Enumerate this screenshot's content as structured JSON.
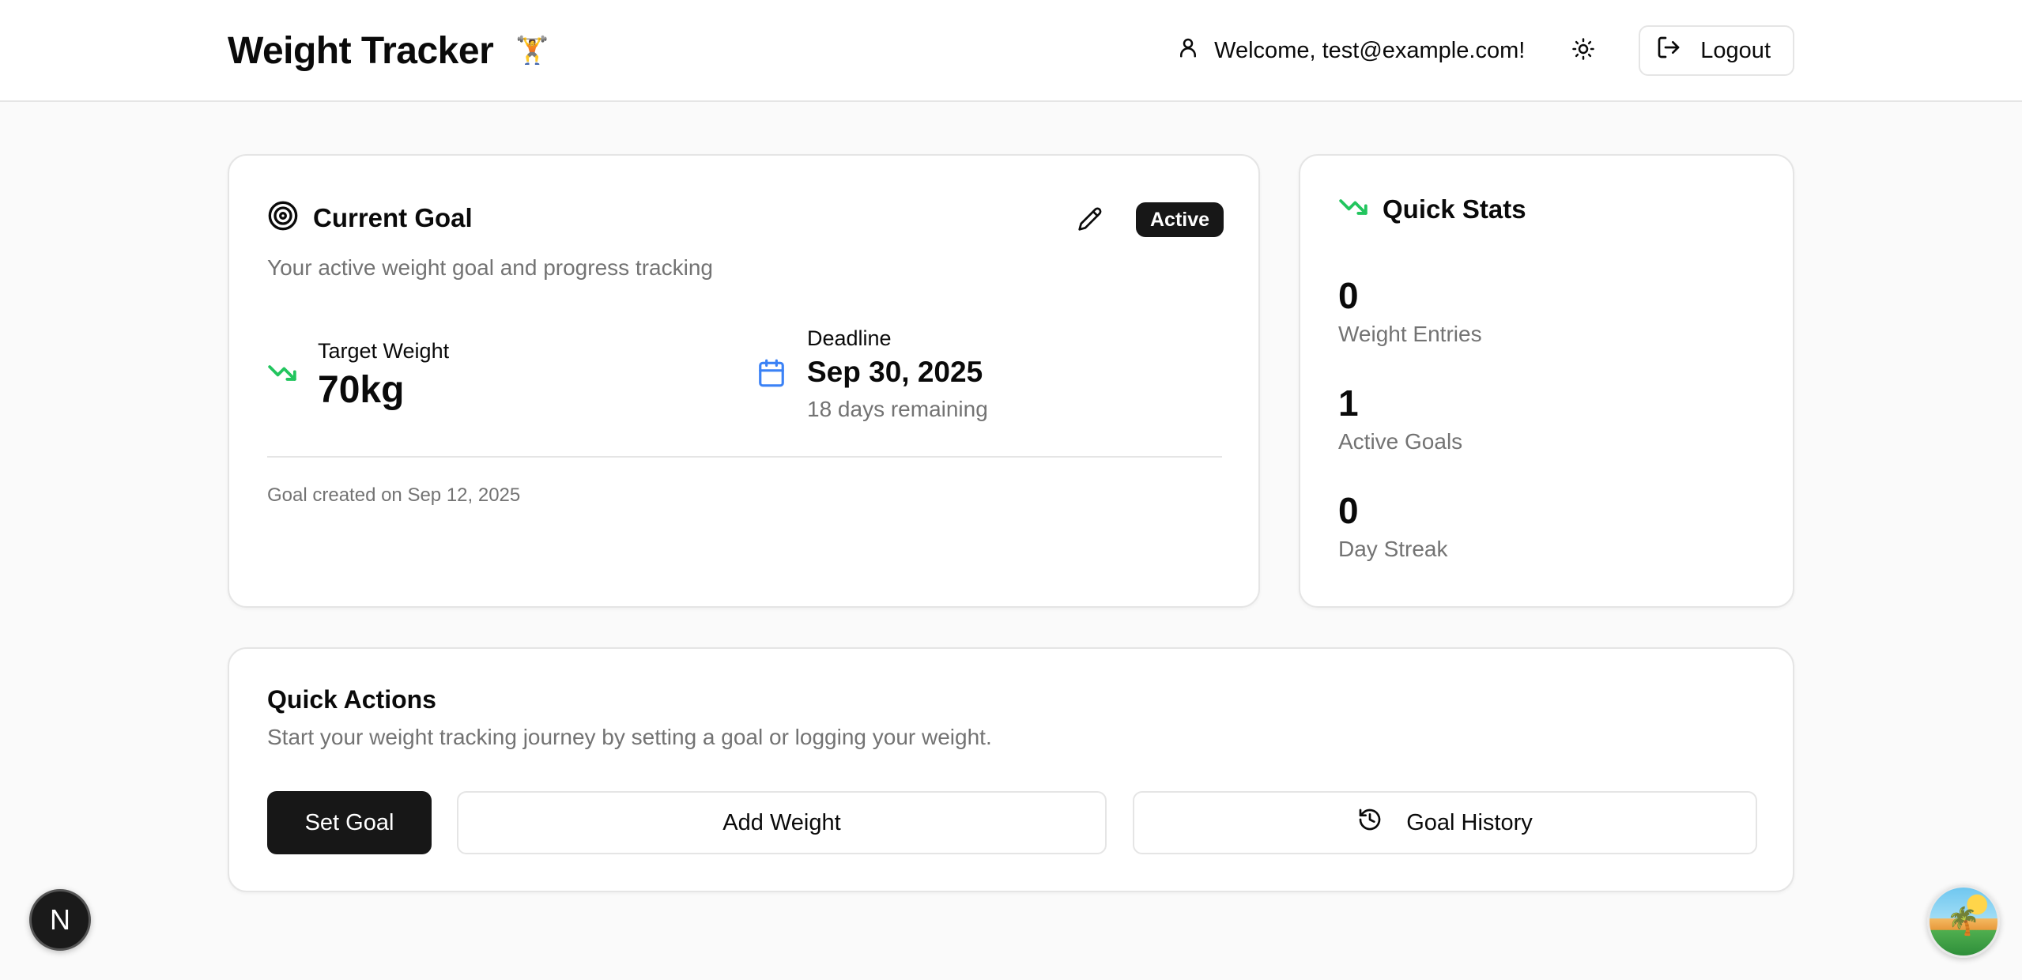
{
  "header": {
    "title": "Weight Tracker",
    "emoji": "🏋️",
    "welcome": "Welcome, test@example.com!",
    "logout_label": "Logout"
  },
  "goal": {
    "title": "Current Goal",
    "badge": "Active",
    "description": "Your active weight goal and progress tracking",
    "target_label": "Target Weight",
    "target_value": "70kg",
    "deadline_label": "Deadline",
    "deadline_value": "Sep 30, 2025",
    "days_remaining": "18 days remaining",
    "created": "Goal created on Sep 12, 2025"
  },
  "stats": {
    "title": "Quick Stats",
    "items": [
      {
        "value": "0",
        "label": "Weight Entries"
      },
      {
        "value": "1",
        "label": "Active Goals"
      },
      {
        "value": "0",
        "label": "Day Streak"
      }
    ]
  },
  "actions": {
    "title": "Quick Actions",
    "description": "Start your weight tracking journey by setting a goal or logging your weight.",
    "set_goal": "Set Goal",
    "add_weight": "Add Weight",
    "goal_history": "Goal History"
  },
  "dev": {
    "next_badge": "N"
  },
  "colors": {
    "accent_green": "#22c55e",
    "accent_blue": "#3b82f6",
    "primary": "#171717"
  }
}
